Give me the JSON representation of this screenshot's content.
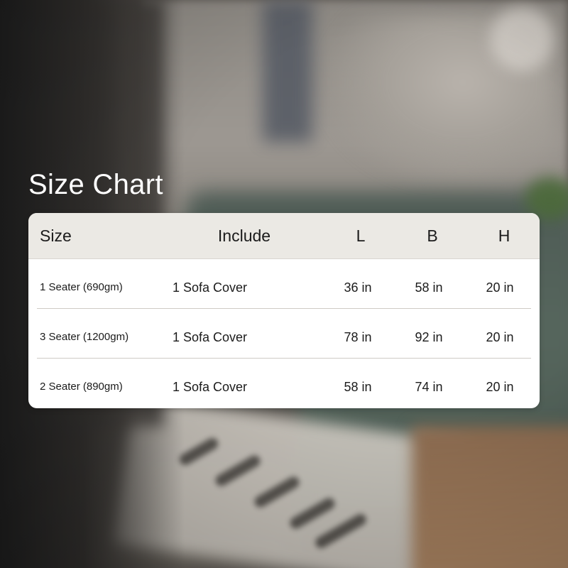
{
  "title": "Size Chart",
  "table": {
    "headers": [
      "Size",
      "Include",
      "L",
      "B",
      "H"
    ],
    "rows": [
      [
        "1 Seater (690gm)",
        "1 Sofa Cover",
        "36 in",
        "58 in",
        "20 in"
      ],
      [
        "3 Seater (1200gm)",
        "1 Sofa Cover",
        "78 in",
        "92 in",
        "20 in"
      ],
      [
        "2 Seater (890gm)",
        "1 Sofa Cover",
        "58 in",
        "74 in",
        "20 in"
      ]
    ]
  }
}
